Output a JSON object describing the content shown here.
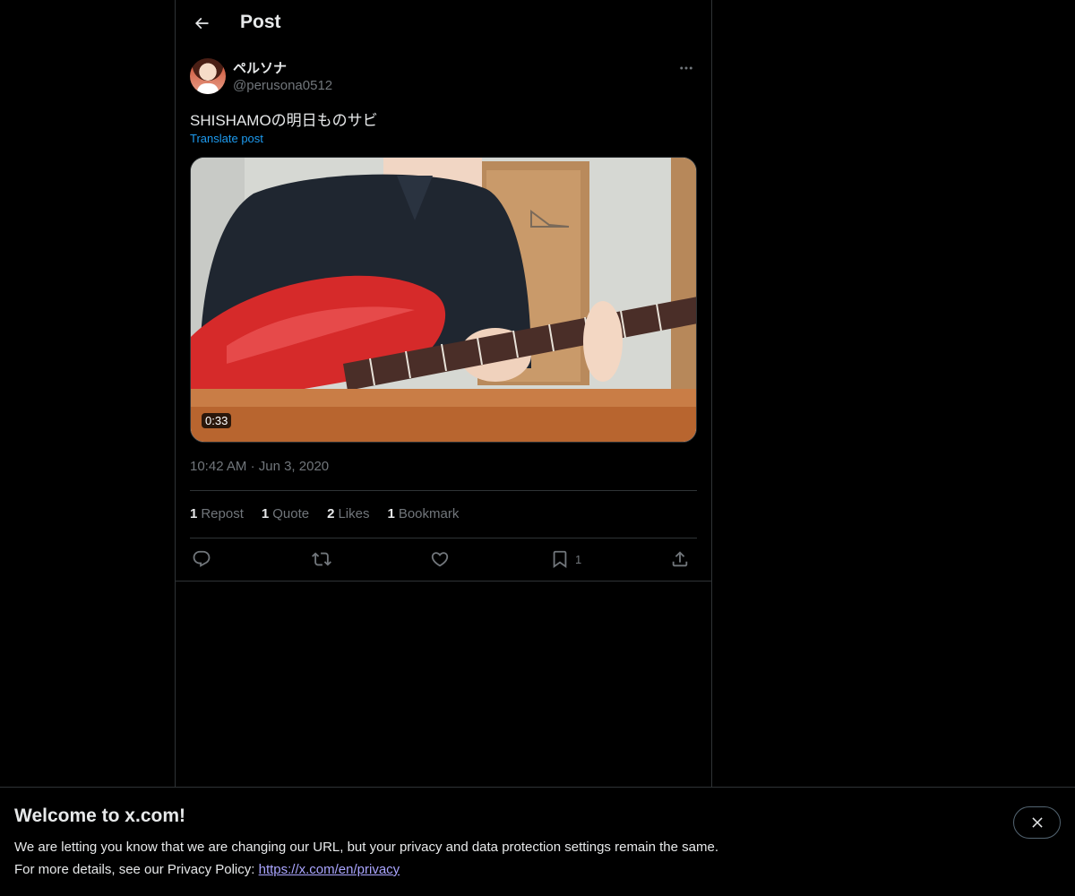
{
  "header": {
    "title": "Post"
  },
  "post": {
    "author": {
      "display_name": "ペルソナ",
      "handle": "@perusona0512"
    },
    "text": "SHISHAMOの明日ものサビ",
    "translate_label": "Translate post",
    "video": {
      "duration": "0:33"
    },
    "time": "10:42 AM",
    "date": "Jun 3, 2020",
    "separator": "·"
  },
  "stats": [
    {
      "count": "1",
      "label": "Repost"
    },
    {
      "count": "1",
      "label": "Quote"
    },
    {
      "count": "2",
      "label": "Likes"
    },
    {
      "count": "1",
      "label": "Bookmark"
    }
  ],
  "actions": {
    "reply": "reply-icon",
    "repost": "repost-icon",
    "like": "heart-icon",
    "bookmark": "bookmark-icon",
    "bookmark_count": "1",
    "share": "share-icon"
  },
  "banner": {
    "title": "Welcome to x.com!",
    "line1": "We are letting you know that we are changing our URL, but your privacy and data protection settings remain the same.",
    "line2_prefix": "For more details, see our Privacy Policy:",
    "link": "https://x.com/en/privacy"
  },
  "colors": {
    "background": "#000000",
    "text": "#e7e9ea",
    "muted": "#71767b",
    "link": "#1d9bf0",
    "divider": "#2f3336"
  }
}
